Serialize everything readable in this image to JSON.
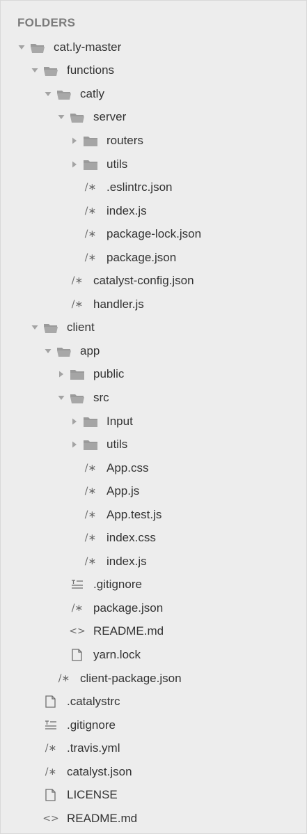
{
  "sidebar": {
    "header": "FOLDERS",
    "items": [
      {
        "label": "cat.ly-master",
        "depth": 0,
        "kind": "folder-open",
        "icon": "folder-open-icon"
      },
      {
        "label": "functions",
        "depth": 1,
        "kind": "folder-open",
        "icon": "folder-open-icon"
      },
      {
        "label": "catly",
        "depth": 2,
        "kind": "folder-open",
        "icon": "folder-open-icon"
      },
      {
        "label": "server",
        "depth": 3,
        "kind": "folder-open",
        "icon": "folder-open-icon"
      },
      {
        "label": "routers",
        "depth": 4,
        "kind": "folder-closed",
        "icon": "folder-closed-icon"
      },
      {
        "label": "utils",
        "depth": 4,
        "kind": "folder-closed",
        "icon": "folder-closed-icon"
      },
      {
        "label": ".eslintrc.json",
        "depth": 4,
        "kind": "file",
        "icon": "code-comment-icon",
        "glyph": "/∗"
      },
      {
        "label": "index.js",
        "depth": 4,
        "kind": "file",
        "icon": "code-comment-icon",
        "glyph": "/∗"
      },
      {
        "label": "package-lock.json",
        "depth": 4,
        "kind": "file",
        "icon": "code-comment-icon",
        "glyph": "/∗"
      },
      {
        "label": "package.json",
        "depth": 4,
        "kind": "file",
        "icon": "code-comment-icon",
        "glyph": "/∗"
      },
      {
        "label": "catalyst-config.json",
        "depth": 3,
        "kind": "file",
        "icon": "code-comment-icon",
        "glyph": "/∗"
      },
      {
        "label": "handler.js",
        "depth": 3,
        "kind": "file",
        "icon": "code-comment-icon",
        "glyph": "/∗"
      },
      {
        "label": "client",
        "depth": 1,
        "kind": "folder-open",
        "icon": "folder-open-icon"
      },
      {
        "label": "app",
        "depth": 2,
        "kind": "folder-open",
        "icon": "folder-open-icon"
      },
      {
        "label": "public",
        "depth": 3,
        "kind": "folder-closed",
        "icon": "folder-closed-icon"
      },
      {
        "label": "src",
        "depth": 3,
        "kind": "folder-open",
        "icon": "folder-open-icon"
      },
      {
        "label": "Input",
        "depth": 4,
        "kind": "folder-closed",
        "icon": "folder-closed-icon"
      },
      {
        "label": "utils",
        "depth": 4,
        "kind": "folder-closed",
        "icon": "folder-closed-icon"
      },
      {
        "label": "App.css",
        "depth": 4,
        "kind": "file",
        "icon": "code-comment-icon",
        "glyph": "/∗"
      },
      {
        "label": "App.js",
        "depth": 4,
        "kind": "file",
        "icon": "code-comment-icon",
        "glyph": "/∗"
      },
      {
        "label": "App.test.js",
        "depth": 4,
        "kind": "file",
        "icon": "code-comment-icon",
        "glyph": "/∗"
      },
      {
        "label": "index.css",
        "depth": 4,
        "kind": "file",
        "icon": "code-comment-icon",
        "glyph": "/∗"
      },
      {
        "label": "index.js",
        "depth": 4,
        "kind": "file",
        "icon": "code-comment-icon",
        "glyph": "/∗"
      },
      {
        "label": ".gitignore",
        "depth": 3,
        "kind": "file",
        "icon": "text-lines-icon"
      },
      {
        "label": "package.json",
        "depth": 3,
        "kind": "file",
        "icon": "code-comment-icon",
        "glyph": "/∗"
      },
      {
        "label": "README.md",
        "depth": 3,
        "kind": "file",
        "icon": "code-brackets-icon",
        "glyph": "<>"
      },
      {
        "label": "yarn.lock",
        "depth": 3,
        "kind": "file",
        "icon": "blank-file-icon"
      },
      {
        "label": "client-package.json",
        "depth": 2,
        "kind": "file",
        "icon": "code-comment-icon",
        "glyph": "/∗"
      },
      {
        "label": ".catalystrc",
        "depth": 1,
        "kind": "file",
        "icon": "blank-file-icon"
      },
      {
        "label": ".gitignore",
        "depth": 1,
        "kind": "file",
        "icon": "text-lines-icon"
      },
      {
        "label": ".travis.yml",
        "depth": 1,
        "kind": "file",
        "icon": "code-comment-icon",
        "glyph": "/∗"
      },
      {
        "label": "catalyst.json",
        "depth": 1,
        "kind": "file",
        "icon": "code-comment-icon",
        "glyph": "/∗"
      },
      {
        "label": "LICENSE",
        "depth": 1,
        "kind": "file",
        "icon": "blank-file-icon"
      },
      {
        "label": "README.md",
        "depth": 1,
        "kind": "file",
        "icon": "code-brackets-icon",
        "glyph": "<>"
      }
    ]
  },
  "colors": {
    "background": "#ededed",
    "header": "#7b7b7b",
    "text": "#333333",
    "folder": "#8f8f8f",
    "caret": "#a3a3a3"
  }
}
